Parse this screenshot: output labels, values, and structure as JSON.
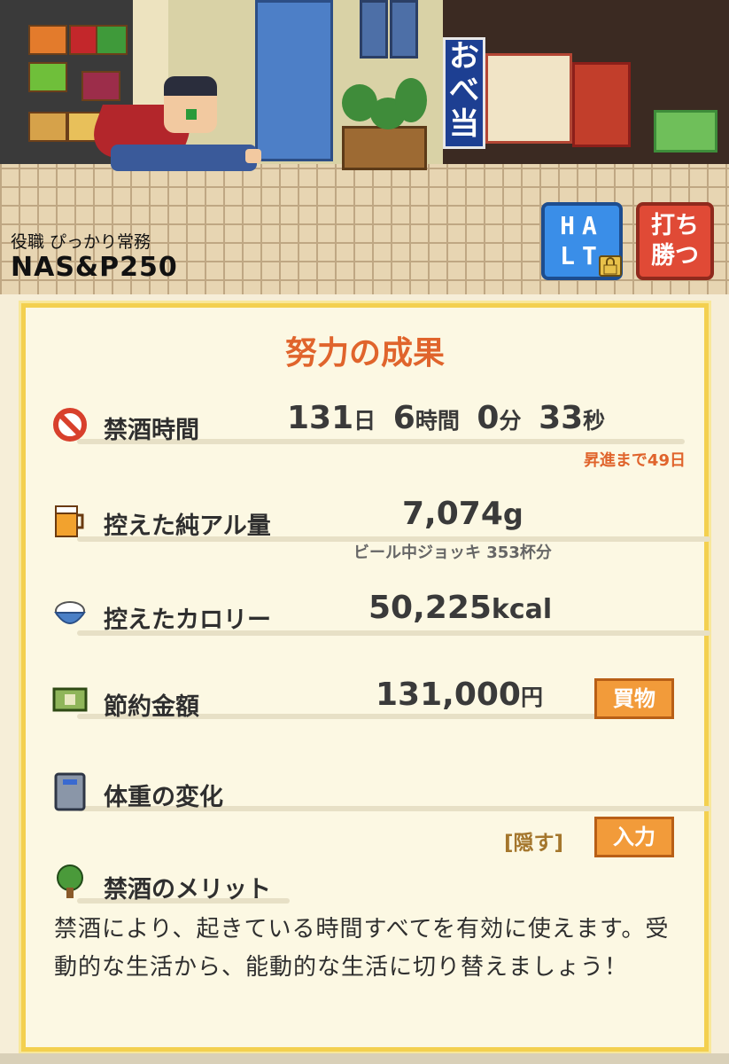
{
  "scene": {
    "shop_banner": "おべ当"
  },
  "player": {
    "role": "役職 ぴっかり常務",
    "name": "NAS&P250"
  },
  "buttons": {
    "halt_line1": "HA",
    "halt_line2": "LT",
    "win_line1": "打ち",
    "win_line2": "勝つ"
  },
  "panel": {
    "title": "努力の成果",
    "abstinence": {
      "label": "禁酒時間",
      "days": "131",
      "days_unit": "日",
      "hours": "6",
      "hours_unit": "時間",
      "minutes": "0",
      "minutes_unit": "分",
      "seconds": "33",
      "seconds_unit": "秒",
      "promotion": "昇進まで49日"
    },
    "alcohol": {
      "label": "控えた純アル量",
      "value": "7,074",
      "unit": "g",
      "note": "ビール中ジョッキ 353杯分"
    },
    "calories": {
      "label": "控えたカロリー",
      "value": "50,225",
      "unit": "kcal"
    },
    "savings": {
      "label": "節約金額",
      "value": "131,000",
      "unit": "円",
      "button": "買物"
    },
    "weight": {
      "label": "体重の変化",
      "hide_link": "[隠す]",
      "input_button": "入力"
    },
    "merit": {
      "title": "禁酒のメリット",
      "text": "禁酒により、起きている時間すべてを有効に使えます。受動的な生活から、能動的な生活に切り替えましょう！"
    }
  },
  "colors": {
    "accent_orange": "#e0642c",
    "panel_border": "#f3d04f",
    "halt_blue": "#3a8ee8",
    "win_red": "#e04a36",
    "button_orange": "#f29b3a"
  },
  "icons": {
    "abstinence": "no-drinking-icon",
    "alcohol": "beer-mug-icon",
    "calories": "rice-bowl-icon",
    "savings": "money-bill-icon",
    "weight": "scale-icon",
    "merit": "tree-icon",
    "lock": "lock-icon"
  }
}
